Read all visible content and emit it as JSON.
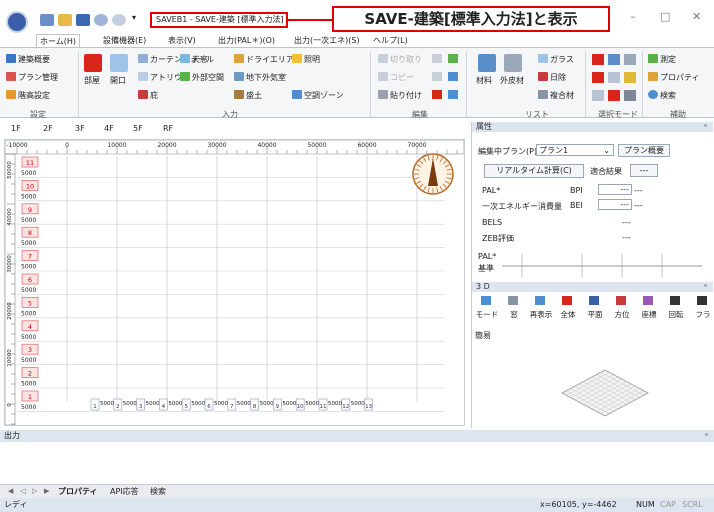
{
  "window": {
    "title": "SAVEB1 - SAVE-建築 [標準入力法]",
    "callout": "SAVE-建築[標準入力法]と表示",
    "min": "–",
    "max": "□",
    "close": "✕"
  },
  "tabs": [
    "ホーム(H)",
    "設備機器(E)",
    "表示(V)",
    "出力(PAL＊)(O)",
    "出力(一次エネ)(S)",
    "ヘルプ(L)"
  ],
  "ribbon": {
    "setting": {
      "items": [
        "建築概要",
        "プラン管理",
        "階高設定"
      ],
      "group": "設定"
    },
    "input": {
      "room": "部屋",
      "opening": "開口",
      "curtain": "カーテンウォール",
      "atrium": "アトリウム",
      "skylight": "天窓",
      "outdoor": "外部空間",
      "eaves": "庇",
      "dryarea": "ドライエリア",
      "underground": "地下外気室",
      "fill": "盛土",
      "lighting": "照明",
      "aczone": "空調ゾーン",
      "group": "入力"
    },
    "edit": {
      "cut": "切り取り",
      "copy": "コピー",
      "paste": "貼り付け",
      "group": "編集"
    },
    "list": {
      "material": "材料",
      "exterior": "外皮材",
      "glass": "ガラス",
      "shade": "日除",
      "composite": "複合材",
      "group": "リスト"
    },
    "selmode": {
      "group": "選択モード"
    },
    "assist": {
      "measure": "測定",
      "property": "プロパティ",
      "search": "検索",
      "group": "補助"
    }
  },
  "floors": [
    "1F",
    "2F",
    "3F",
    "4F",
    "5F",
    "RF"
  ],
  "canvas": {
    "xticks": [
      "-10000",
      "0",
      "10000",
      "20000",
      "30000",
      "40000",
      "50000",
      "60000",
      "70000"
    ],
    "yticks": [
      "50000",
      "40000",
      "30000",
      "20000",
      "10000",
      "0"
    ],
    "rows": [
      "11",
      "10",
      "9",
      "8",
      "7",
      "6",
      "5",
      "4",
      "3",
      "2",
      "1"
    ],
    "span": "5000",
    "cols": [
      "1",
      "2",
      "3",
      "4",
      "5",
      "6",
      "7",
      "8",
      "9",
      "10",
      "11",
      "12",
      "13"
    ]
  },
  "props": {
    "header": "属性",
    "plan_label": "編集中プラン(P)",
    "plan_value": "プラン1",
    "overview": "プラン概要",
    "realtime": "リアルタイム計算(C)",
    "fit": "適合結果",
    "fit_value": "---",
    "pal": "PAL*",
    "bpi": "BPI",
    "bpi_value": "---",
    "bpi_value2": "---",
    "primary": "一次エネルギー消費量",
    "bei": "BEI",
    "bei_value": "---",
    "bei_value2": "---",
    "bels": "BELS",
    "bels_value": "---",
    "zeb": "ZEB評価",
    "zeb_value": "---",
    "pal_base": "PAL*",
    "base": "基準"
  },
  "view3d": {
    "header": "3 D",
    "tools": [
      "モード",
      "窓",
      "再表示",
      "全体",
      "平面",
      "方位",
      "座標",
      "回転",
      "フラ"
    ],
    "mode": "簡易"
  },
  "output": {
    "header": "出力"
  },
  "bottom_tabs": [
    "プロパティ",
    "API応答",
    "検索"
  ],
  "status": {
    "left": "レディ",
    "coords": "x=60105, y=-4462",
    "num": "NUM",
    "cap": "CAP",
    "scrl": "SCRL"
  },
  "colors": {
    "accent": "#e00000",
    "ribbon": "#f5f6f8",
    "panel": "#dde5f0",
    "row": "#e06060"
  }
}
